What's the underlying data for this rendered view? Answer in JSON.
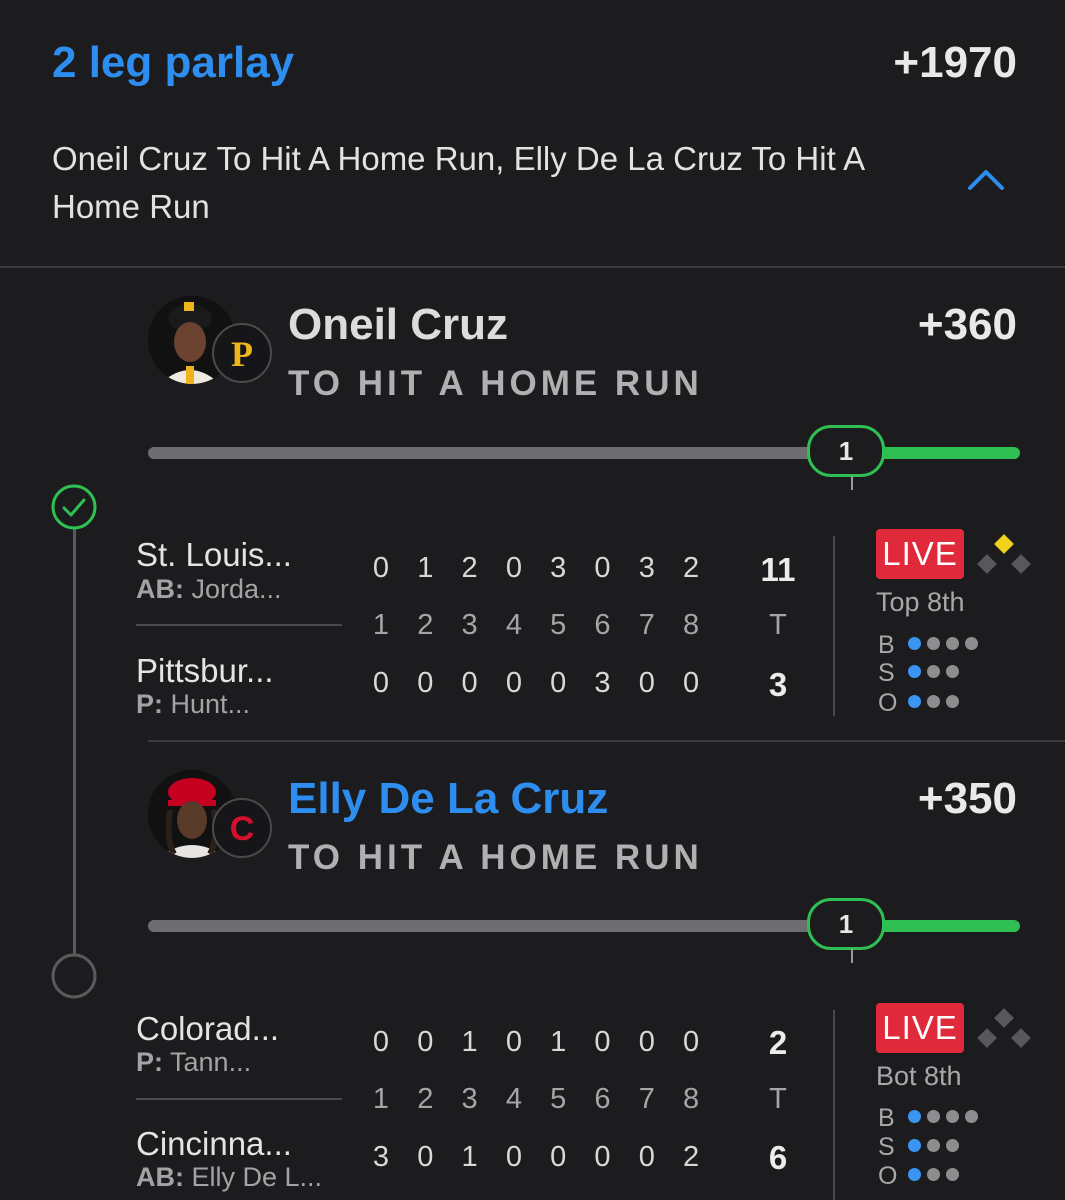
{
  "parlay": {
    "title": "2 leg parlay",
    "odds": "+1970",
    "description": "Oneil Cruz To Hit A Home Run, Elly De La Cruz To Hit A Home Run"
  },
  "legs": [
    {
      "player": "Oneil Cruz",
      "market": "TO HIT A HOME RUN",
      "odds": "+360",
      "progress_value": "1",
      "progress_fraction": 0.8,
      "status": "won",
      "team_logo_letter": "P",
      "game": {
        "away_team": "St. Louis...",
        "away_sub_label": "AB:",
        "away_sub_value": "Jorda...",
        "away_innings": [
          "0",
          "1",
          "2",
          "0",
          "3",
          "0",
          "3",
          "2"
        ],
        "away_total": "11",
        "innings_header": [
          "1",
          "2",
          "3",
          "4",
          "5",
          "6",
          "7",
          "8"
        ],
        "total_header": "T",
        "home_team": "Pittsbur...",
        "home_sub_label": "P:",
        "home_sub_value": "Hunt...",
        "home_innings": [
          "0",
          "0",
          "0",
          "0",
          "0",
          "3",
          "0",
          "0"
        ],
        "home_total": "3",
        "live_label": "LIVE",
        "inning_state": "Top 8th",
        "count": {
          "balls": 1,
          "strikes": 1,
          "outs": 1
        },
        "bases": {
          "first": false,
          "second": true,
          "third": false
        },
        "count_labels": {
          "b": "B",
          "s": "S",
          "o": "O"
        }
      }
    },
    {
      "player": "Elly De La Cruz",
      "market": "TO HIT A HOME RUN",
      "odds": "+350",
      "progress_value": "1",
      "progress_fraction": 0.8,
      "status": "pending",
      "team_logo_letter": "C",
      "game": {
        "away_team": "Colorad...",
        "away_sub_label": "P:",
        "away_sub_value": "Tann...",
        "away_innings": [
          "0",
          "0",
          "1",
          "0",
          "1",
          "0",
          "0",
          "0"
        ],
        "away_total": "2",
        "innings_header": [
          "1",
          "2",
          "3",
          "4",
          "5",
          "6",
          "7",
          "8"
        ],
        "total_header": "T",
        "home_team": "Cincinna...",
        "home_sub_label": "AB:",
        "home_sub_value": "Elly De L...",
        "home_innings": [
          "3",
          "0",
          "1",
          "0",
          "0",
          "0",
          "0",
          "2"
        ],
        "home_total": "6",
        "live_label": "LIVE",
        "inning_state": "Bot 8th",
        "count": {
          "balls": 1,
          "strikes": 1,
          "outs": 1
        },
        "bases": {
          "first": false,
          "second": false,
          "third": false
        },
        "count_labels": {
          "b": "B",
          "s": "S",
          "o": "O"
        }
      }
    }
  ],
  "colors": {
    "accent": "#2d8ef0",
    "success": "#2fbf52",
    "live": "#e0293b",
    "base_occupied": "#f2d21b",
    "base_empty": "#58585a",
    "count_on": "#3a94f1"
  }
}
